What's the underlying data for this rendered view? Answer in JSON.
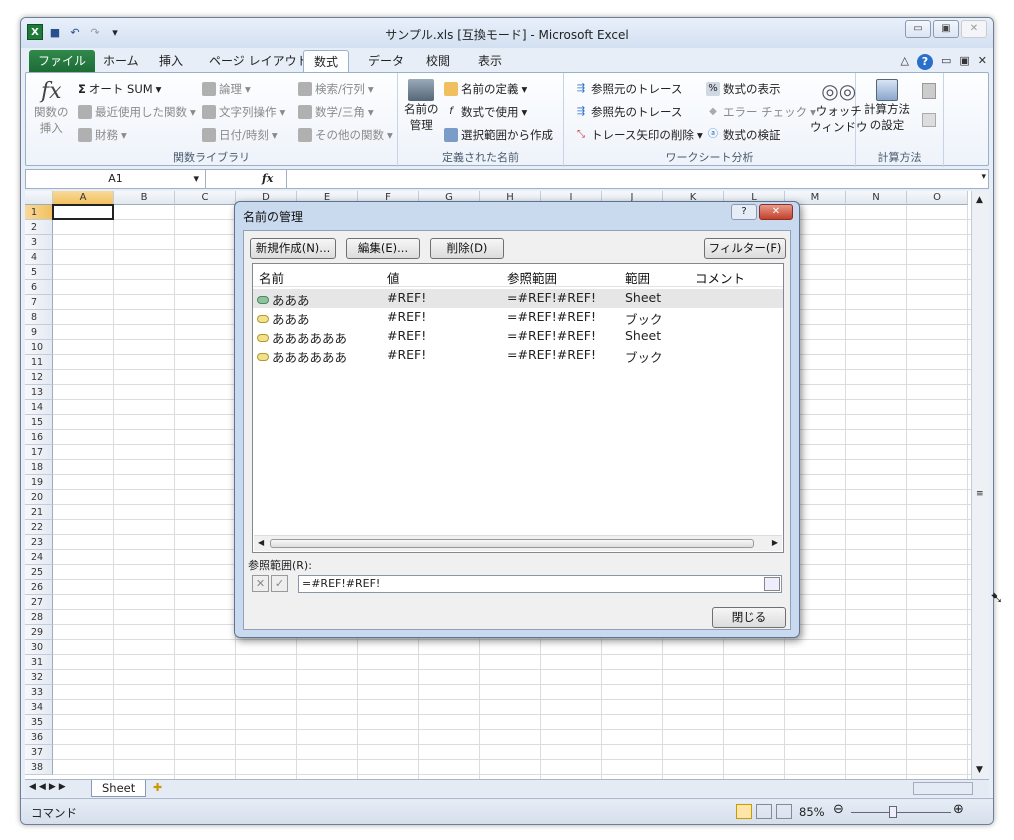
{
  "window": {
    "title": "サンプル.xls  [互換モード] - Microsoft Excel"
  },
  "tabs": [
    "ファイル",
    "ホーム",
    "挿入",
    "ページ レイアウト",
    "数式",
    "データ",
    "校閲",
    "表示"
  ],
  "active_tab": "数式",
  "ribbon": {
    "insert_function": "関数の\n挿入",
    "insert_function_l1": "関数の",
    "insert_function_l2": "挿入",
    "autosum": "オート SUM",
    "recent": "最近使用した関数",
    "financial": "財務",
    "logical": "論理",
    "text": "文字列操作",
    "datetime": "日付/時刻",
    "lookup": "検索/行列",
    "math": "数学/三角",
    "more": "その他の関数",
    "group1": "関数ライブラリ",
    "name_manager_l1": "名前の",
    "name_manager_l2": "管理",
    "define_name": "名前の定義",
    "use_in_formula": "数式で使用",
    "create_from_sel": "選択範囲から作成",
    "group2": "定義された名前",
    "trace_precedents": "参照元のトレース",
    "trace_dependents": "参照先のトレース",
    "remove_arrows": "トレース矢印の削除",
    "show_formulas": "数式の表示",
    "error_check": "エラー チェック",
    "evaluate": "数式の検証",
    "watch_l1": "ウォッチ",
    "watch_l2": "ウィンドウ",
    "group3": "ワークシート分析",
    "calc_l1": "計算方法",
    "calc_l2": "の設定",
    "group4": "計算方法"
  },
  "formula_bar": {
    "namebox": "A1",
    "fx": "fx"
  },
  "columns": [
    "A",
    "B",
    "C",
    "D",
    "E",
    "F",
    "G",
    "H",
    "I",
    "J",
    "K",
    "L",
    "M",
    "N",
    "O"
  ],
  "rows": [
    "1",
    "2",
    "3",
    "4",
    "5",
    "6",
    "7",
    "8",
    "9",
    "10",
    "11",
    "12",
    "13",
    "14",
    "15",
    "16",
    "17",
    "18",
    "19",
    "20",
    "21",
    "22",
    "23",
    "24",
    "25",
    "26",
    "27",
    "28",
    "29",
    "30",
    "31",
    "32",
    "33",
    "34",
    "35",
    "36",
    "37",
    "38"
  ],
  "sheet_tab": "Sheet",
  "status": {
    "mode": "コマンド",
    "zoom": "85%"
  },
  "dialog": {
    "title": "名前の管理",
    "new_btn": "新規作成(N)...",
    "edit_btn": "編集(E)...",
    "delete_btn": "削除(D)",
    "filter_btn": "フィルター(F)",
    "headers": [
      "名前",
      "値",
      "参照範囲",
      "範囲",
      "コメント"
    ],
    "rows": [
      {
        "name": "あああ",
        "value": "#REF!",
        "ref": "=#REF!#REF!",
        "scope": "Sheet"
      },
      {
        "name": "あああ",
        "value": "#REF!",
        "ref": "=#REF!#REF!",
        "scope": "ブック"
      },
      {
        "name": "ああああああ",
        "value": "#REF!",
        "ref": "=#REF!#REF!",
        "scope": "Sheet"
      },
      {
        "name": "ああああああ",
        "value": "#REF!",
        "ref": "=#REF!#REF!",
        "scope": "ブック"
      }
    ],
    "refers_label": "参照範囲(R):",
    "refers_value": "=#REF!#REF!",
    "close_btn": "閉じる"
  }
}
